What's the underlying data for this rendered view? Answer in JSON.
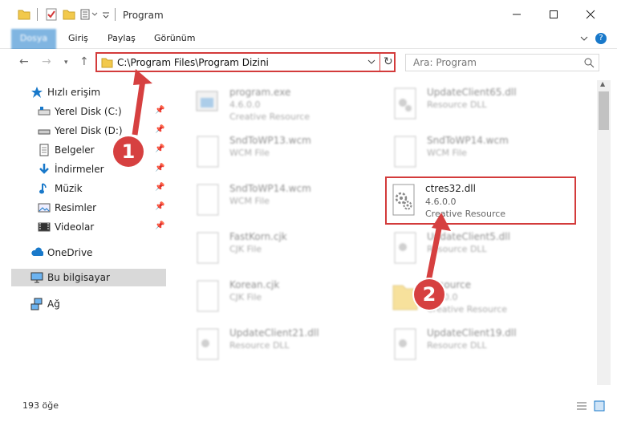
{
  "window": {
    "title": "Program",
    "minimize_icon": "minimize-icon",
    "maximize_icon": "maximize-icon",
    "close_icon": "close-icon"
  },
  "ribbon": {
    "tabs": [
      "Dosya",
      "Giriş",
      "Paylaş",
      "Görünüm"
    ]
  },
  "nav": {
    "address": "C:\\Program Files\\Program Dizini",
    "search_placeholder": "Ara: Program"
  },
  "sidebar": {
    "items": [
      {
        "label": "Hızlı erişim",
        "icon": "star-icon"
      },
      {
        "label": "Yerel Disk (C:)",
        "icon": "drive-icon"
      },
      {
        "label": "Yerel Disk (D:)",
        "icon": "drive-icon"
      },
      {
        "label": "Belgeler",
        "icon": "documents-icon"
      },
      {
        "label": "İndirmeler",
        "icon": "download-icon"
      },
      {
        "label": "Müzik",
        "icon": "music-icon"
      },
      {
        "label": "Resimler",
        "icon": "pictures-icon"
      },
      {
        "label": "Videolar",
        "icon": "videos-icon"
      },
      {
        "label": "OneDrive",
        "icon": "cloud-icon"
      },
      {
        "label": "Bu bilgisayar",
        "icon": "computer-icon"
      },
      {
        "label": "Ağ",
        "icon": "network-icon"
      }
    ]
  },
  "files": [
    {
      "name": "program.exe",
      "line2": "4.6.0.0",
      "line3": "Creative Resource"
    },
    {
      "name": "UpdateClient65.dll",
      "line2": "Resource DLL",
      "line3": ""
    },
    {
      "name": "SndToWP13.wcm",
      "line2": "WCM File",
      "line3": ""
    },
    {
      "name": "SndToWP14.wcm",
      "line2": "WCM File",
      "line3": ""
    },
    {
      "name": "SndToWP14.wcm",
      "line2": "WCM File",
      "line3": ""
    },
    {
      "name": "ctres32.dll",
      "line2": "4.6.0.0",
      "line3": "Creative Resource"
    },
    {
      "name": "FastKorn.cjk",
      "line2": "CJK File",
      "line3": ""
    },
    {
      "name": "UpdateClient5.dll",
      "line2": "Resource DLL",
      "line3": ""
    },
    {
      "name": "Korean.cjk",
      "line2": "CJK File",
      "line3": ""
    },
    {
      "name": "Resource",
      "line2": "4.6.0.0",
      "line3": "Creative Resource"
    },
    {
      "name": "UpdateClient21.dll",
      "line2": "Resource DLL",
      "line3": ""
    },
    {
      "name": "UpdateClient19.dll",
      "line2": "Resource DLL",
      "line3": ""
    }
  ],
  "status": {
    "count": "193 öğe"
  },
  "annotations": {
    "step1": "1",
    "step2": "2",
    "color": "#d33b3b"
  }
}
